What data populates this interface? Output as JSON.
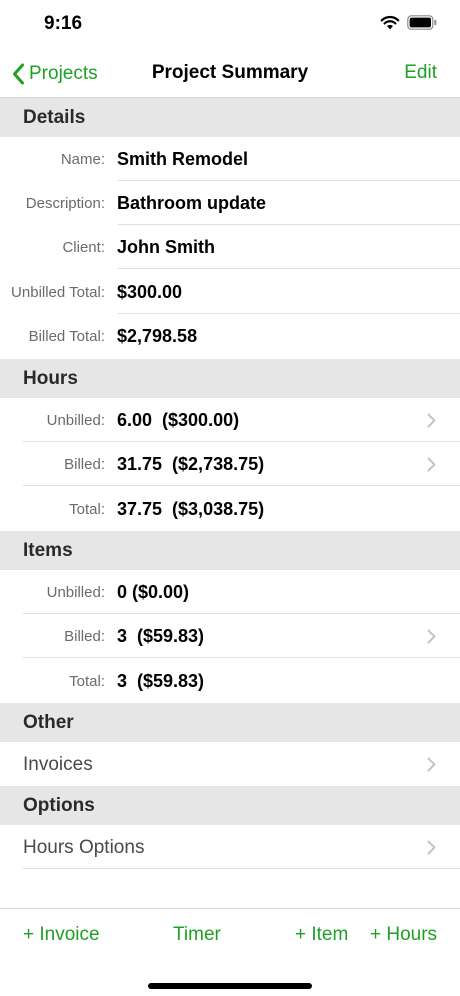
{
  "status_bar": {
    "time": "9:16"
  },
  "nav": {
    "back_label": "Projects",
    "title": "Project Summary",
    "edit_label": "Edit"
  },
  "details": {
    "header": "Details",
    "rows": [
      {
        "label": "Name:",
        "value": "Smith Remodel"
      },
      {
        "label": "Description:",
        "value": "Bathroom update"
      },
      {
        "label": "Client:",
        "value": "John Smith"
      },
      {
        "label": "Unbilled Total:",
        "value": "$300.00"
      },
      {
        "label": "Billed Total:",
        "value": "$2,798.58"
      }
    ]
  },
  "hours": {
    "header": "Hours",
    "rows": [
      {
        "label": "Unbilled:",
        "value": "6.00  ($300.00)"
      },
      {
        "label": "Billed:",
        "value": "31.75  ($2,738.75)"
      },
      {
        "label": "Total:",
        "value": "37.75  ($3,038.75)"
      }
    ]
  },
  "items": {
    "header": "Items",
    "rows": [
      {
        "label": "Unbilled:",
        "value": "0 ($0.00)"
      },
      {
        "label": "Billed:",
        "value": "3  ($59.83)"
      },
      {
        "label": "Total:",
        "value": "3  ($59.83)"
      }
    ]
  },
  "other": {
    "header": "Other",
    "invoices_label": "Invoices"
  },
  "options": {
    "header": "Options",
    "hours_options_label": "Hours Options"
  },
  "toolbar": {
    "invoice": "+ Invoice",
    "timer": "Timer",
    "item": "+ Item",
    "hours": "+ Hours"
  },
  "colors": {
    "accent": "#1fa024",
    "section_bg": "#e6e6e6"
  },
  "icons": {
    "back": "chevron-left-icon",
    "disclosure": "chevron-right-icon",
    "wifi": "wifi-icon",
    "battery": "battery-icon"
  }
}
